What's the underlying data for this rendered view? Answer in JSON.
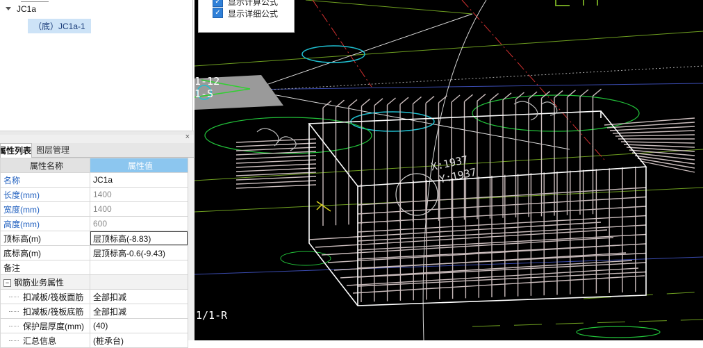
{
  "tree": {
    "node_label": "JC1a",
    "child_label": "（底）JC1a-1"
  },
  "panel": {
    "close_icon": "×",
    "tabs": [
      {
        "label": "属性列表",
        "active": true
      },
      {
        "label": "图层管理",
        "active": false
      }
    ]
  },
  "properties": {
    "header": {
      "name": "属性名称",
      "value": "属性值"
    },
    "rows": [
      {
        "name": "名称",
        "value": "JC1a"
      },
      {
        "name": "长度(mm)",
        "value": "1400"
      },
      {
        "name": "宽度(mm)",
        "value": "1400"
      },
      {
        "name": "高度(mm)",
        "value": "600"
      },
      {
        "name": "顶标高(m)",
        "value": "层顶标高(-8.83)"
      },
      {
        "name": "底标高(m)",
        "value": "层顶标高-0.6(-9.43)"
      },
      {
        "name": "备注",
        "value": ""
      }
    ],
    "group": {
      "expander": "−",
      "label": "钢筋业务属性",
      "rows": [
        {
          "name": "扣减板/筏板面筋",
          "value": "全部扣减"
        },
        {
          "name": "扣减板/筏板底筋",
          "value": "全部扣减"
        },
        {
          "name": "保护层厚度(mm)",
          "value": "(40)"
        },
        {
          "name": "汇总信息",
          "value": "(桩承台)"
        }
      ]
    }
  },
  "options": {
    "checkboxes": [
      {
        "label": "显示计算公式",
        "checked": true
      },
      {
        "label": "显示详细公式",
        "checked": true
      }
    ]
  },
  "canvas": {
    "axis_labels": [
      "1-12",
      "1-S",
      "1/1-R"
    ],
    "coord_readout": [
      "X:1937",
      "Y:1937"
    ],
    "background": "#000000",
    "rebar_color": "#cbbdbd",
    "box_color": "#ffffff",
    "circle_color": "#22c23a",
    "cyan_color": "#1fbfd0"
  }
}
